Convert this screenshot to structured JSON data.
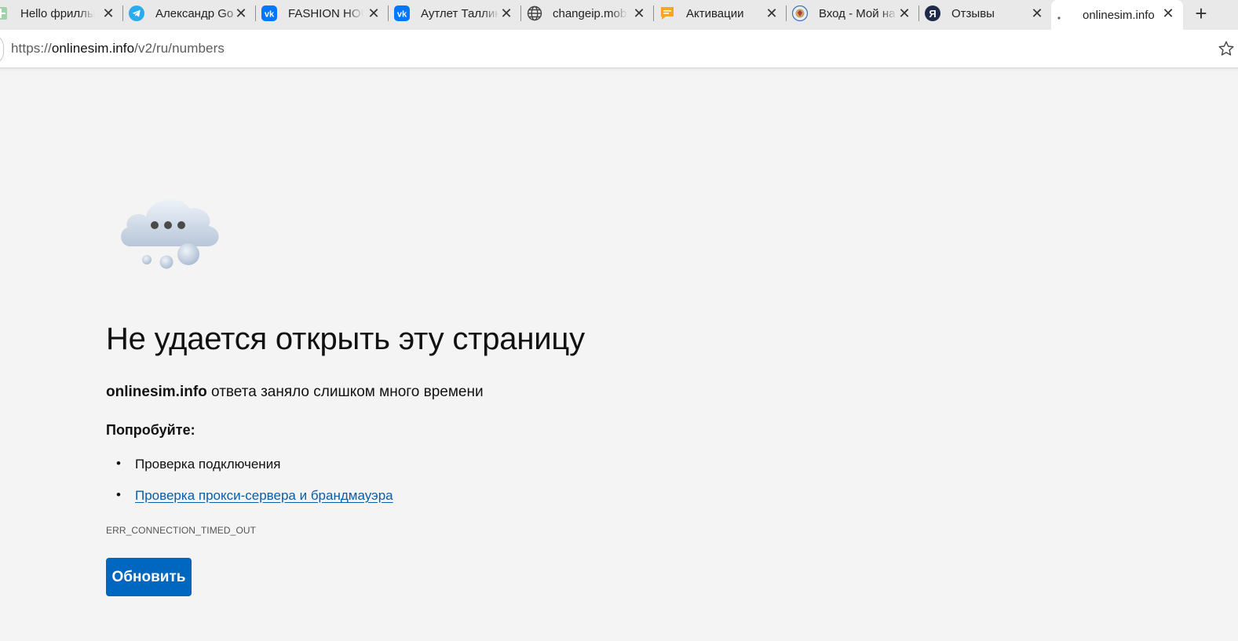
{
  "browser": {
    "tabs": [
      {
        "title": "Hello фриллы",
        "icon": "sheets-icon",
        "icon_color": "#21a464"
      },
      {
        "title": "Александр Gо",
        "icon": "telegram-icon",
        "icon_color": "#2aabee"
      },
      {
        "title": "FASHION HOU",
        "icon": "vk-icon",
        "icon_color": "#0077ff"
      },
      {
        "title": "Аутлет Таллин",
        "icon": "vk-icon",
        "icon_color": "#0077ff"
      },
      {
        "title": "changeip.mob",
        "icon": "globe-icon",
        "icon_color": "#444444"
      },
      {
        "title": "Активации",
        "icon": "chat-icon",
        "icon_color": "#f5a623"
      },
      {
        "title": "Вход - Мой на",
        "icon": "emblem-icon",
        "icon_color": "#3a6fb5"
      },
      {
        "title": "Отзывы",
        "icon": "yandex-icon",
        "icon_color": "#1e2a48"
      },
      {
        "title": "onlinesim.info",
        "icon": "loading-dot-icon",
        "icon_color": "#666666",
        "active": true
      }
    ],
    "new_tab_symbol": "+",
    "close_symbol": "✕",
    "address": {
      "scheme": "https://",
      "host": "onlinesim.info",
      "path": "/v2/ru/numbers"
    }
  },
  "error_page": {
    "title": "Не удается открыть эту страницу",
    "description_host": "onlinesim.info",
    "description_text": " ответа заняло слишком много времени",
    "try_label": "Попробуйте:",
    "bullet_symbol": "•",
    "suggestions": [
      {
        "text": "Проверка подключения",
        "link": false
      },
      {
        "text": "Проверка прокси-сервера и брандмауэра",
        "link": true
      }
    ],
    "error_code": "ERR_CONNECTION_TIMED_OUT",
    "reload_label": "Обновить",
    "accent_color": "#0067c0",
    "link_color": "#0a5ea8"
  }
}
